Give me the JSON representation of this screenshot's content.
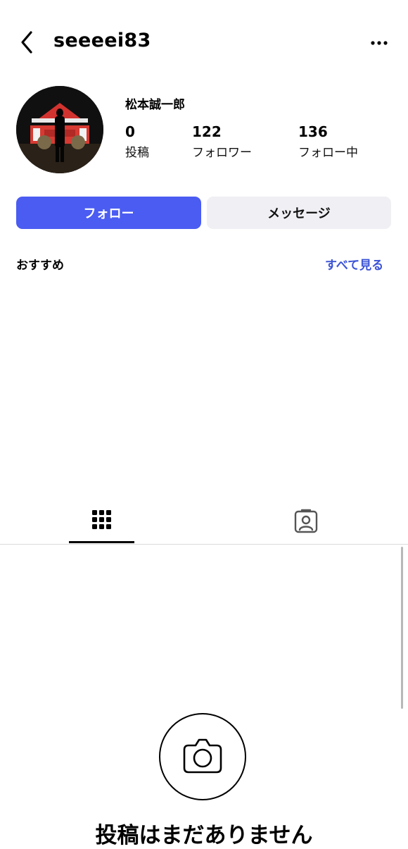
{
  "header": {
    "back_icon": "chevron-left-icon",
    "username": "seeeei83",
    "more_icon": "more-horizontal-icon"
  },
  "profile": {
    "avatar_icon": "avatar",
    "display_name": "松本誠一郎",
    "stats": [
      {
        "value": "0",
        "label": "投稿"
      },
      {
        "value": "122",
        "label": "フォロワー"
      },
      {
        "value": "136",
        "label": "フォロー中"
      }
    ]
  },
  "actions": {
    "follow_label": "フォロー",
    "message_label": "メッセージ"
  },
  "recommendations": {
    "title": "おすすめ",
    "see_all_label": "すべて見る"
  },
  "tabs": [
    {
      "icon": "grid-icon",
      "active": true
    },
    {
      "icon": "tagged-person-icon",
      "active": false
    }
  ],
  "empty_state": {
    "icon": "camera-icon",
    "text": "投稿はまだありません"
  },
  "colors": {
    "accent": "#4a5cf2",
    "link": "#3b53d6",
    "secondary_button": "#efeff4"
  }
}
